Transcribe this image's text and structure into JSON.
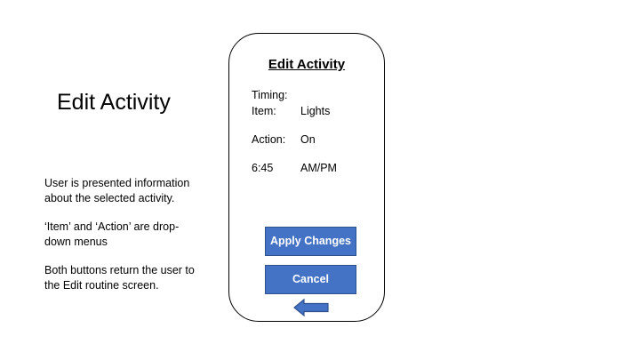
{
  "slide": {
    "title": "Edit Activity",
    "notes": [
      "User is presented information about the selected activity.",
      "‘Item’ and ‘Action’ are drop-down menus",
      "Both buttons return the user to the Edit routine screen."
    ]
  },
  "phone": {
    "title": "Edit Activity",
    "timing_label": "Timing:",
    "item_label": "Item:",
    "item_value": "Lights",
    "action_label": "Action:",
    "action_value": "On",
    "time_value": "6:45",
    "ampm_value": "AM/PM",
    "apply_button": "Apply Changes",
    "cancel_button": "Cancel",
    "back_icon": "left-arrow-icon"
  },
  "colors": {
    "button_fill": "#4472c4",
    "button_border": "#2f528f",
    "text": "#000000"
  }
}
